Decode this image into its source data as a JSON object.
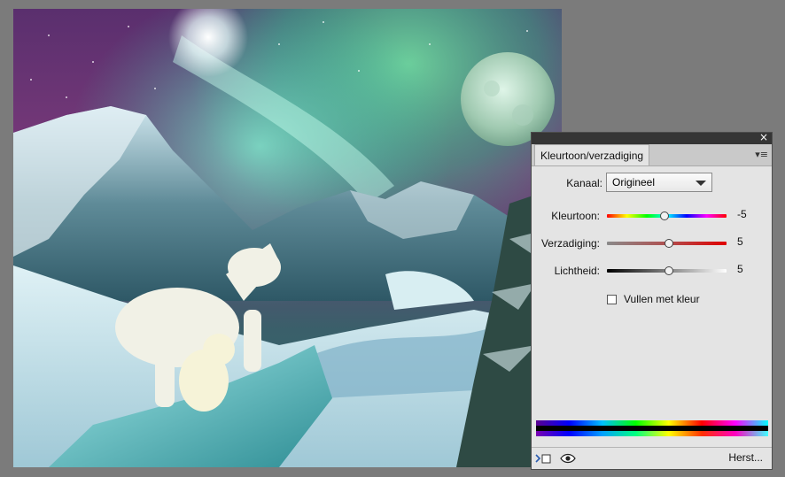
{
  "panel": {
    "close": "×",
    "tab_label": "Kleurtoon/verzadiging",
    "menu_icon": "panel-menu-icon",
    "channel_label": "Kanaal:",
    "channel_value": "Origineel",
    "sliders": [
      {
        "label": "Kleurtoon:",
        "value": "-5",
        "level": 0.48
      },
      {
        "label": "Verzadiging:",
        "value": "5",
        "level": 0.52
      },
      {
        "label": "Lichtheid:",
        "value": "5",
        "level": 0.52
      }
    ],
    "colorize_label": "Vullen met kleur",
    "colorize_checked": false,
    "reset_label": "Herst..."
  },
  "colors": {
    "workspace": "#7b7b7b",
    "panel_bg": "#e4e4e4"
  },
  "icons": [
    "clip-to-layer-icon",
    "visibility-eye-icon",
    "close-icon",
    "chevron-down-icon"
  ]
}
